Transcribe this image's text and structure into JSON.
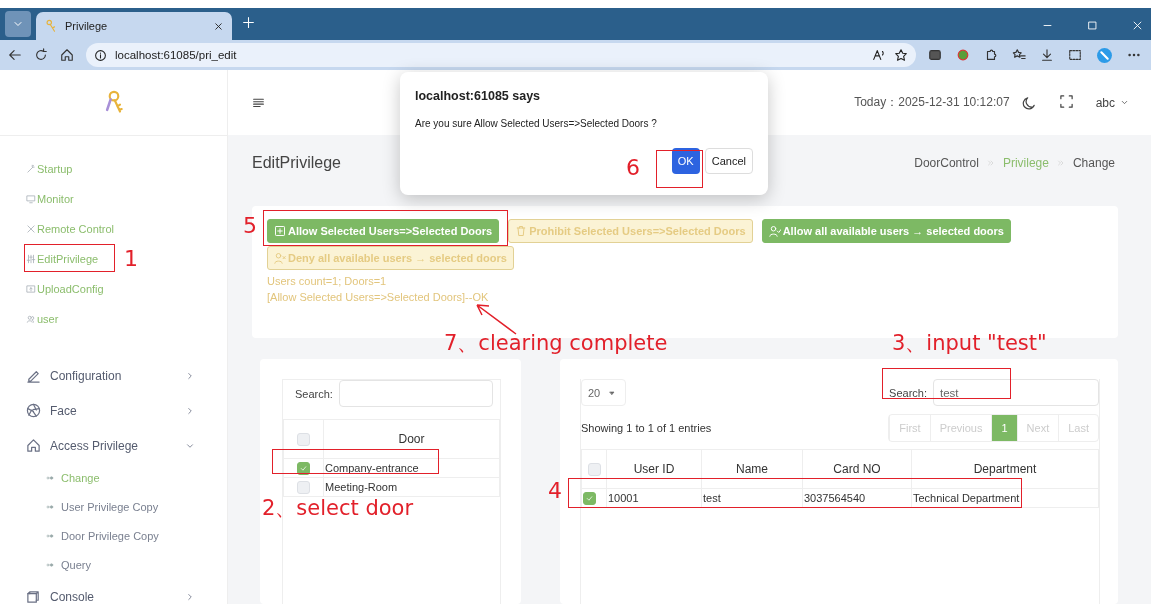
{
  "browser": {
    "tab_title": "Privilege",
    "url": "localhost:61085/pri_edit"
  },
  "header": {
    "date_label": "Today：",
    "datetime": "2025-12-31 10:12:07",
    "user": "abc"
  },
  "sidebar": {
    "links": [
      {
        "label": "Startup"
      },
      {
        "label": "Monitor"
      },
      {
        "label": "Remote Control"
      },
      {
        "label": "EditPrivilege"
      },
      {
        "label": "UploadConfig"
      },
      {
        "label": "user"
      }
    ],
    "groups": [
      {
        "label": "Configuration",
        "expanded": false
      },
      {
        "label": "Face",
        "expanded": false
      },
      {
        "label": "Access Privilege",
        "expanded": true,
        "children": [
          {
            "label": "Change",
            "selected": true
          },
          {
            "label": "User Privilege Copy",
            "selected": false
          },
          {
            "label": "Door Privilege Copy",
            "selected": false
          },
          {
            "label": "Query",
            "selected": false
          }
        ]
      },
      {
        "label": "Console",
        "expanded": false
      }
    ]
  },
  "page": {
    "title": "EditPrivilege",
    "breadcrumb": [
      {
        "label": "DoorControl",
        "kind": "plain"
      },
      {
        "label": "Privilege",
        "kind": "link"
      },
      {
        "label": "Change",
        "kind": "plain"
      }
    ]
  },
  "actions": {
    "buttons": [
      {
        "label": "Allow Selected Users=>Selected Doors",
        "kind": "success"
      },
      {
        "label": "Prohibit Selected Users=>Selected Doors",
        "kind": "warning"
      },
      {
        "label": "Allow all available users → selected doors",
        "kind": "success"
      },
      {
        "label": "Deny all available users → selected doors",
        "kind": "warning"
      }
    ],
    "messages": [
      "Users count=1; Doors=1",
      "[Allow Selected Users=>Selected Doors]--OK"
    ]
  },
  "door_table": {
    "search_label": "Search:",
    "all_checked": false,
    "columns": [
      "Door"
    ],
    "rows": [
      {
        "door": "Company-entrance",
        "checked": true
      },
      {
        "door": "Meeting-Room",
        "checked": false
      }
    ]
  },
  "user_table": {
    "page_size": "20",
    "search_label": "Search:",
    "search_value": "test",
    "info": "Showing 1 to 1 of 1 entries",
    "pagination": [
      {
        "label": "First",
        "selected": false,
        "disabled": true
      },
      {
        "label": "Previous",
        "selected": false,
        "disabled": true
      },
      {
        "label": "1",
        "selected": true,
        "disabled": false
      },
      {
        "label": "Next",
        "selected": false,
        "disabled": true
      },
      {
        "label": "Last",
        "selected": false,
        "disabled": true
      }
    ],
    "all_checked": false,
    "columns": [
      "User ID",
      "Name",
      "Card NO",
      "Department"
    ],
    "rows": [
      {
        "cells": [
          "10001",
          "test",
          "3037564540",
          "Technical Department"
        ],
        "checked": true
      }
    ]
  },
  "dialog": {
    "title": "localhost:61085 says",
    "message": "Are you sure Allow Selected Users=>Selected Doors ?",
    "ok": "OK",
    "cancel": "Cancel"
  },
  "annotations": [
    {
      "label": "1"
    },
    {
      "label": "2、select door"
    },
    {
      "label": "3、input \"test\""
    },
    {
      "label": "4"
    },
    {
      "label": "5"
    },
    {
      "label": "6"
    },
    {
      "label": "7、clearing complete"
    }
  ]
}
